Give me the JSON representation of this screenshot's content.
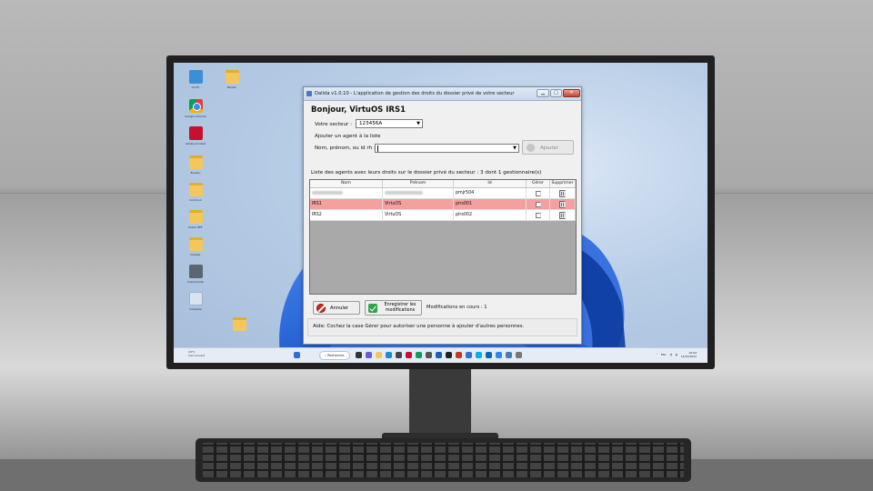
{
  "desktop": {
    "icons": [
      {
        "label": "Ce PC",
        "kind": "pc"
      },
      {
        "label": "Mosaïc",
        "kind": "folder"
      },
      {
        "label": "Google Chrome",
        "kind": "chrome"
      },
      {
        "label": "Adobe Acrobat",
        "kind": "pdf"
      },
      {
        "label": "Bureau",
        "kind": "folder"
      },
      {
        "label": "Commun",
        "kind": "folder"
      },
      {
        "label": "Public PEF",
        "kind": "folder"
      },
      {
        "label": "Dossier",
        "kind": "folder"
      },
      {
        "label": "Imprimante",
        "kind": "printer"
      },
      {
        "label": "Corbeille",
        "kind": "recycle"
      }
    ]
  },
  "taskbar": {
    "left_line1": "19°C",
    "left_line2": "Ciel couvert",
    "search_label": "Recherche",
    "language": "FRA",
    "time": "10:04",
    "date": "12/12/2022"
  },
  "window": {
    "title": "Dalida v1.0.10 - L'application de gestion des droits du dossier privé de votre secteur",
    "min_symbol": "▁",
    "max_symbol": "□",
    "close_symbol": "✕",
    "greeting": "Bonjour, VirtuOS IRS1",
    "sector_label": "Votre secteur :",
    "sector_value": "123456A",
    "add_section_label": "Ajouter un agent à la liste",
    "name_label": "Nom, prénom, ou id rh :",
    "name_value": "",
    "add_button": "Ajouter",
    "list_label": "Liste des agents avec leurs droits sur le dossier privé du secteur : 3 dont 1 gestionnaire(s)",
    "columns": {
      "nom": "Nom",
      "prenom": "Prénom",
      "id": "Id",
      "gerer": "Gérer",
      "supprimer": "Supprimer"
    },
    "rows": [
      {
        "nom": "",
        "prenom": "",
        "id": "pmjr504",
        "gerer": false,
        "selected": false,
        "redacted": true
      },
      {
        "nom": "IRS1",
        "prenom": "VirtuOS",
        "id": "pirs001",
        "gerer": true,
        "selected": true,
        "redacted": false
      },
      {
        "nom": "IRS2",
        "prenom": "VirtuOS",
        "id": "pirs002",
        "gerer": false,
        "selected": false,
        "redacted": false
      }
    ],
    "cancel_button": "Annuler",
    "save_button": "Enregistrer les modifications",
    "modifications_label": "Modifications en cours : 1",
    "help_text": "Aide: Cochez la case Gérer pour autoriser une personne à ajouter d'autres personnes."
  },
  "colors": {
    "selected_row": "#f4a0a0",
    "bloom_blue": "#1f5fd1",
    "cancel_red": "#d0241d",
    "save_green": "#2ea34a"
  }
}
